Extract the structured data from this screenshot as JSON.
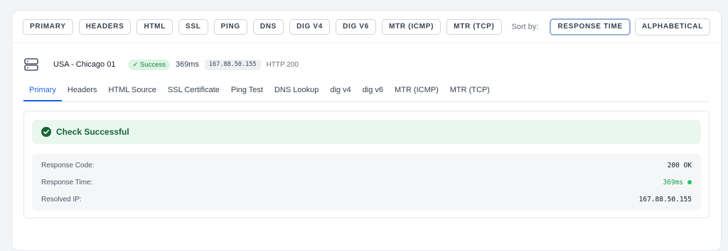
{
  "filters": [
    "PRIMARY",
    "HEADERS",
    "HTML",
    "SSL",
    "PING",
    "DNS",
    "DIG V4",
    "DIG V6",
    "MTR (ICMP)",
    "MTR (TCP)"
  ],
  "sort": {
    "label": "Sort by:",
    "response_time": "RESPONSE TIME",
    "alphabetical": "ALPHABETICAL"
  },
  "result": {
    "location": "USA - Chicago 01",
    "status": "✓ Success",
    "time": "369ms",
    "ip": "167.88.50.155",
    "http": "HTTP 200"
  },
  "tabs": [
    "Primary",
    "Headers",
    "HTML Source",
    "SSL Certificate",
    "Ping Test",
    "DNS Lookup",
    "dig v4",
    "dig v6",
    "MTR (ICMP)",
    "MTR (TCP)"
  ],
  "panel": {
    "title": "Check Successful",
    "rows": [
      {
        "label": "Response Code:",
        "value": "200 OK"
      },
      {
        "label": "Response Time:",
        "value": "369ms"
      },
      {
        "label": "Resolved IP:",
        "value": "167.88.50.155"
      }
    ]
  },
  "colors": {
    "accent": "#2563eb",
    "success": "#16a34a",
    "success_bg": "#eaf7ee"
  },
  "icons": {
    "server": "server-icon",
    "check": "check-circle-icon",
    "status_dot": "status-dot-icon"
  }
}
